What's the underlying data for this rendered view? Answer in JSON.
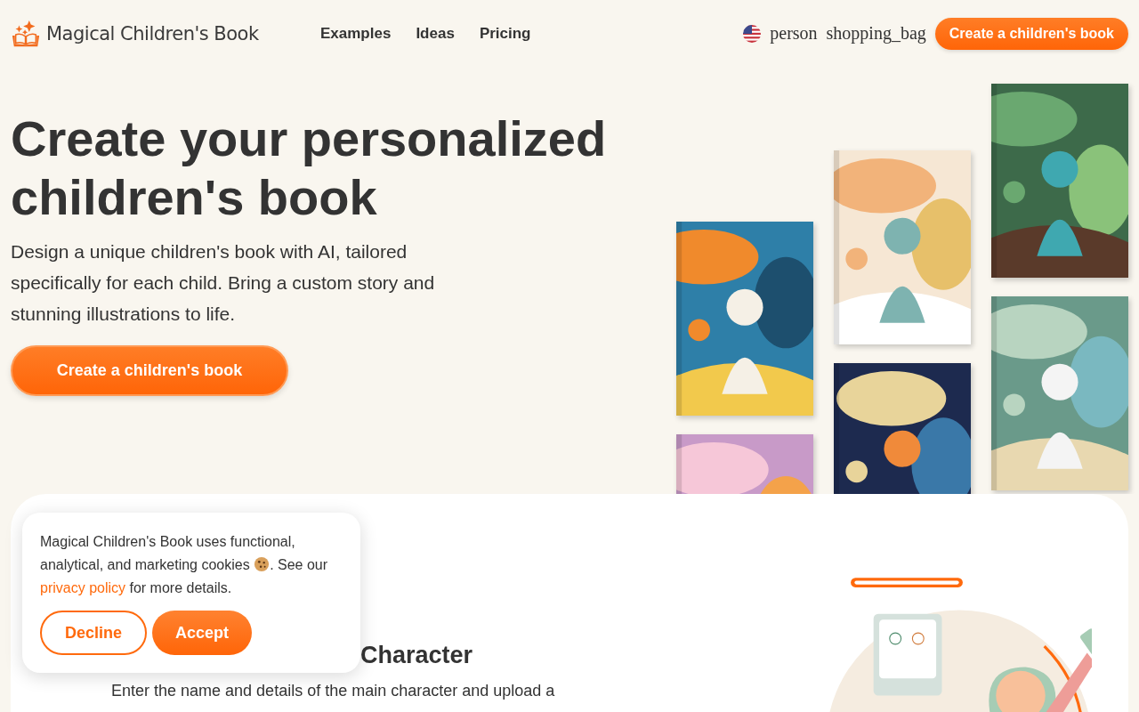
{
  "header": {
    "logo": "Magical Children's Book",
    "nav": [
      "Examples",
      "Ideas",
      "Pricing"
    ],
    "icon_texts": [
      "person",
      "shopping_bag"
    ],
    "cta": "Create a children's book"
  },
  "hero": {
    "title": "Create your personalized children's book",
    "description": "Design a unique children's book with AI, tailored specifically for each child. Bring a custom story and stunning illustrations to life.",
    "cta": "Create a children's book"
  },
  "section": {
    "heading": "Character",
    "description": "Enter the name and details of the main character and upload a"
  },
  "cookie_banner": {
    "text": "Magical Children's Book uses functional, analytical, and marketing cookies",
    "text_mid": ". See our",
    "link": "privacy policy",
    "text_after": "for more details.",
    "buttons": [
      {
        "label": "Decline",
        "kind": "outline"
      },
      {
        "label": "Accept",
        "kind": "filled"
      }
    ]
  }
}
